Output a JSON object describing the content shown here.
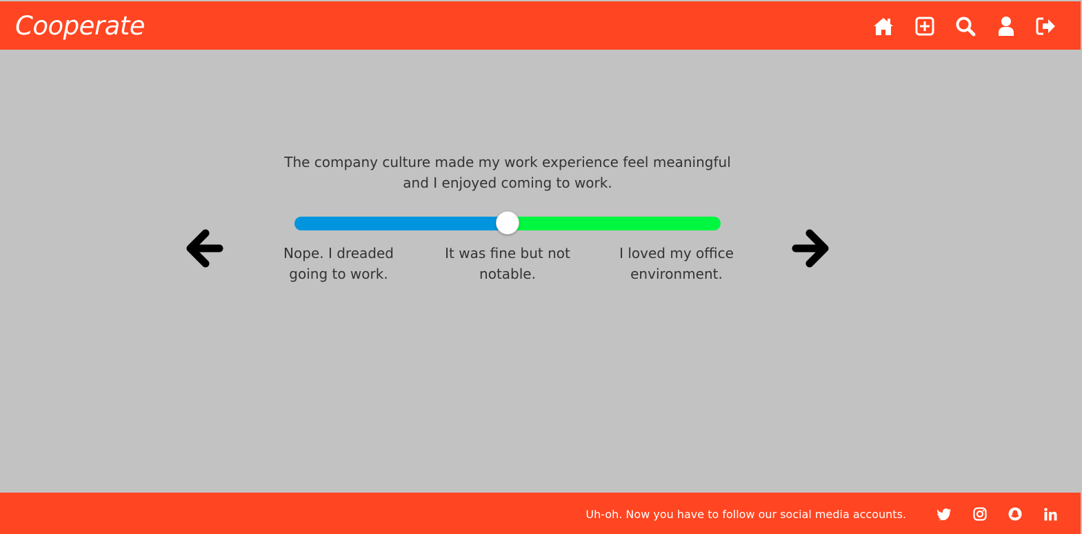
{
  "app": {
    "logo": "Cooperate"
  },
  "nav": {
    "items": [
      {
        "icon": "home-icon"
      },
      {
        "icon": "add-square-icon"
      },
      {
        "icon": "search-icon"
      },
      {
        "icon": "user-icon"
      },
      {
        "icon": "sign-out-icon"
      }
    ]
  },
  "survey": {
    "question": "The company culture made my work experience feel meaningful and I enjoyed coming to work.",
    "slider_value_percent": 50,
    "labels": {
      "low": "Nope. I dreaded going to work.",
      "mid": "It was fine but not notable.",
      "high": "I loved my office environment."
    },
    "prev_icon": "arrow-left-icon",
    "next_icon": "arrow-right-icon"
  },
  "footer": {
    "text": "Uh-oh. Now you have to follow our social media accounts.",
    "social": [
      {
        "icon": "twitter-icon"
      },
      {
        "icon": "instagram-icon"
      },
      {
        "icon": "snapchat-icon"
      },
      {
        "icon": "linkedin-icon"
      }
    ]
  },
  "colors": {
    "brand": "#ff4521",
    "background": "#c2c2c2",
    "slider_low": "#0095de",
    "slider_high": "#00f741"
  }
}
